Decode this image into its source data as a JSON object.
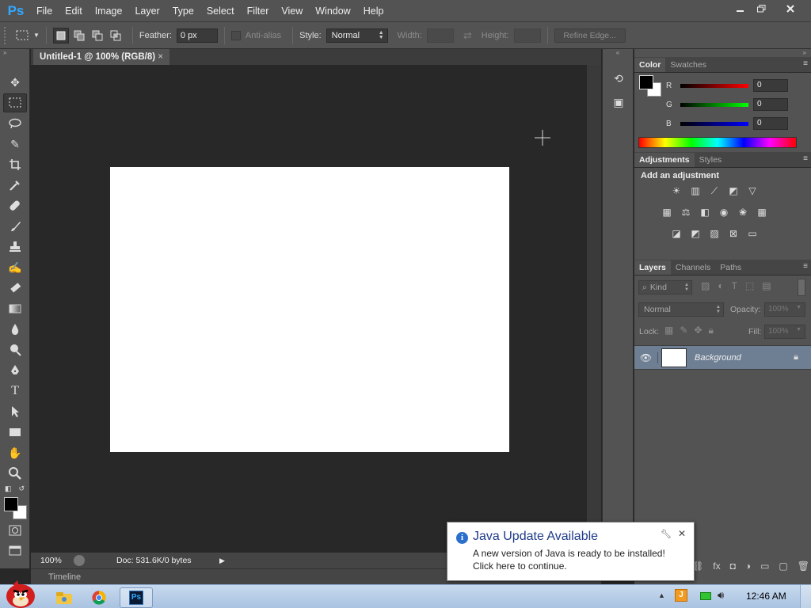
{
  "app": {
    "logo": "Ps"
  },
  "menu": [
    "File",
    "Edit",
    "Image",
    "Layer",
    "Type",
    "Select",
    "Filter",
    "View",
    "Window",
    "Help"
  ],
  "window_controls": {
    "minimize": "minimize-icon",
    "restore": "restore-icon",
    "close": "close-icon"
  },
  "options": {
    "feather_label": "Feather:",
    "feather_value": "0 px",
    "antialias_label": "Anti-alias",
    "style_label": "Style:",
    "style_value": "Normal",
    "width_label": "Width:",
    "height_label": "Height:",
    "refine_edge": "Refine Edge..."
  },
  "document": {
    "tab_title": "Untitled-1 @ 100% (RGB/8)",
    "tab_close": "×",
    "zoom": "100%",
    "doc_info": "Doc: 531.6K/0 bytes",
    "timeline_label": "Timeline"
  },
  "color_panel": {
    "tabs": [
      "Color",
      "Swatches"
    ],
    "r_label": "R",
    "r_value": "0",
    "g_label": "G",
    "g_value": "0",
    "b_label": "B",
    "b_value": "0",
    "foreground": "#000000",
    "background": "#ffffff"
  },
  "adjustments_panel": {
    "tabs": [
      "Adjustments",
      "Styles"
    ],
    "heading": "Add an adjustment"
  },
  "layers_panel": {
    "tabs": [
      "Layers",
      "Channels",
      "Paths"
    ],
    "filter_kind": "Kind",
    "blend_mode": "Normal",
    "opacity_label": "Opacity:",
    "opacity_value": "100%",
    "lock_label": "Lock:",
    "fill_label": "Fill:",
    "fill_value": "100%",
    "layers": [
      {
        "name": "Background"
      }
    ]
  },
  "notification": {
    "title": "Java Update Available",
    "line1": "A new version of Java is ready to be installed!",
    "line2": "Click here to continue."
  },
  "taskbar": {
    "clock": "12:46 AM",
    "ps_label": "Ps"
  }
}
